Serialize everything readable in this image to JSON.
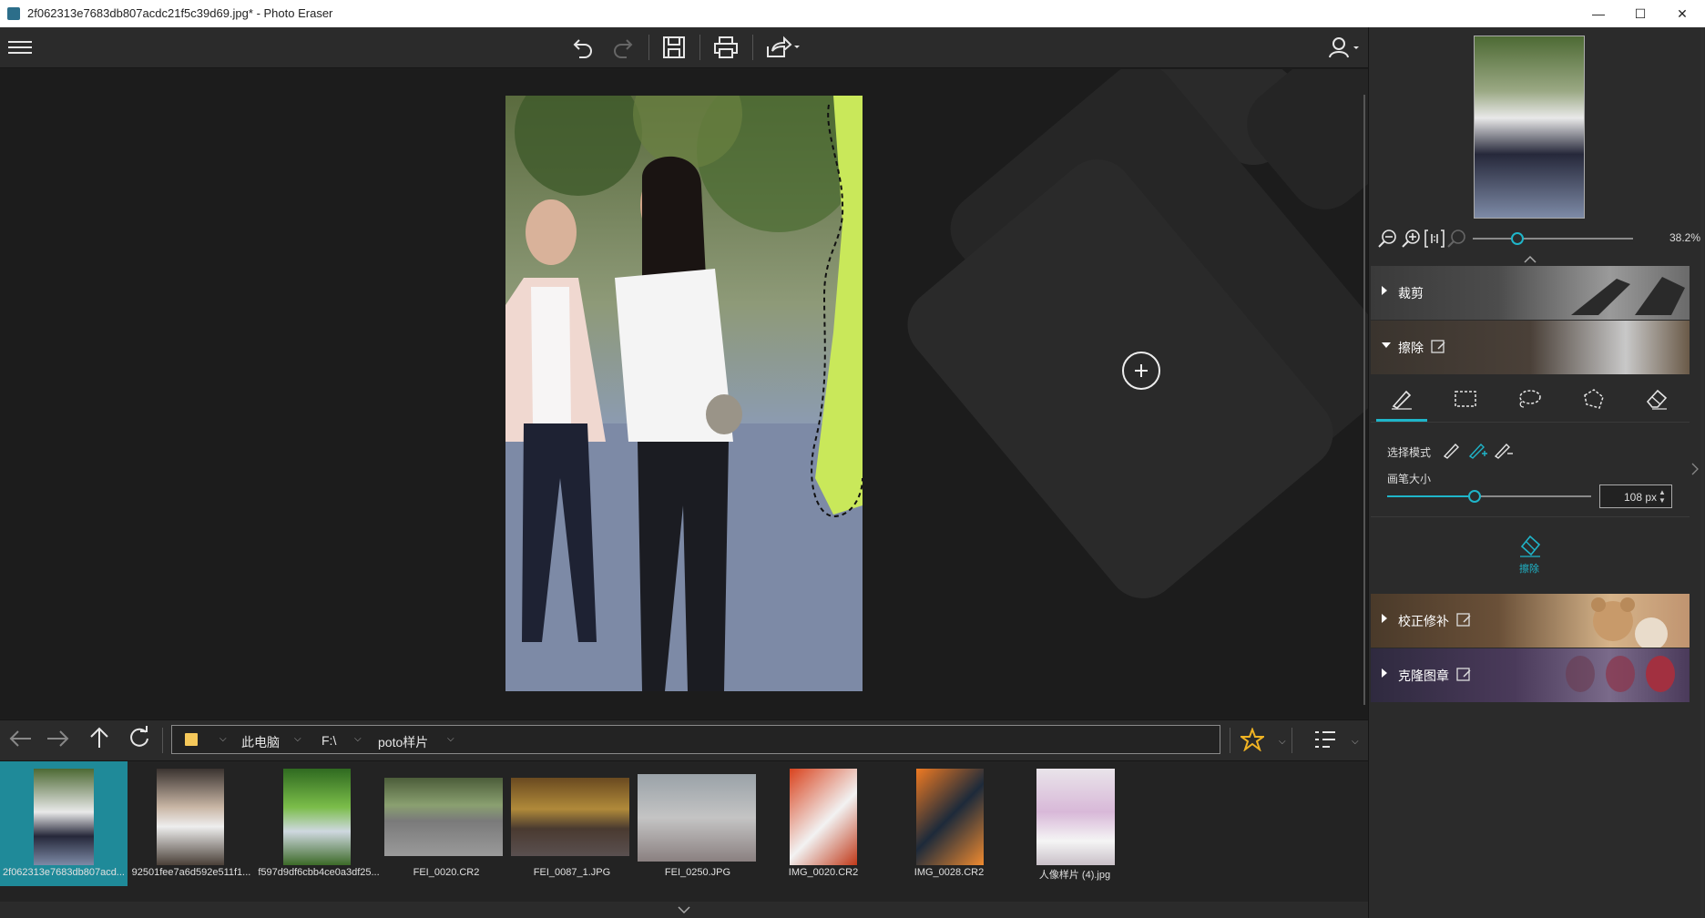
{
  "window": {
    "title": "2f062313e7683db807acdc21f5c39d69.jpg* - Photo Eraser",
    "minimize": "—",
    "maximize": "☐",
    "close": "✕"
  },
  "toolbar": {
    "menu_icon": "hamburger-icon",
    "undo_icon": "undo-icon",
    "redo_icon": "redo-icon",
    "save_icon": "save-icon",
    "print_icon": "print-icon",
    "share_icon": "share-icon",
    "user_icon": "user-icon"
  },
  "navbar": {
    "crumbs": [
      "此电脑",
      "F:\\",
      "poto样片"
    ]
  },
  "filmstrip": {
    "items": [
      {
        "name": "2f062313e7683db807acd...",
        "selected": true
      },
      {
        "name": "92501fee7a6d592e511f1..."
      },
      {
        "name": "f597d9df6cbb4ce0a3df25..."
      },
      {
        "name": "FEI_0020.CR2"
      },
      {
        "name": "FEI_0087_1.JPG"
      },
      {
        "name": "FEI_0250.JPG"
      },
      {
        "name": "IMG_0020.CR2"
      },
      {
        "name": "IMG_0028.CR2"
      },
      {
        "name": "人像样片 (4).jpg"
      }
    ]
  },
  "zoom": {
    "value_label": "38.2%",
    "fraction": 0.28
  },
  "panel": {
    "crop_label": "裁剪",
    "erase_label": "擦除",
    "selection_mode_label": "选择模式",
    "brush_size_label": "画笔大小",
    "brush_size_value": "108 px",
    "brush_fraction": 0.43,
    "erase_button_label": "擦除",
    "correction_label": "校正修补",
    "clone_label": "克隆图章"
  },
  "colors": {
    "accent": "#1fb5c9",
    "selected_thumb": "#1f8a99"
  }
}
